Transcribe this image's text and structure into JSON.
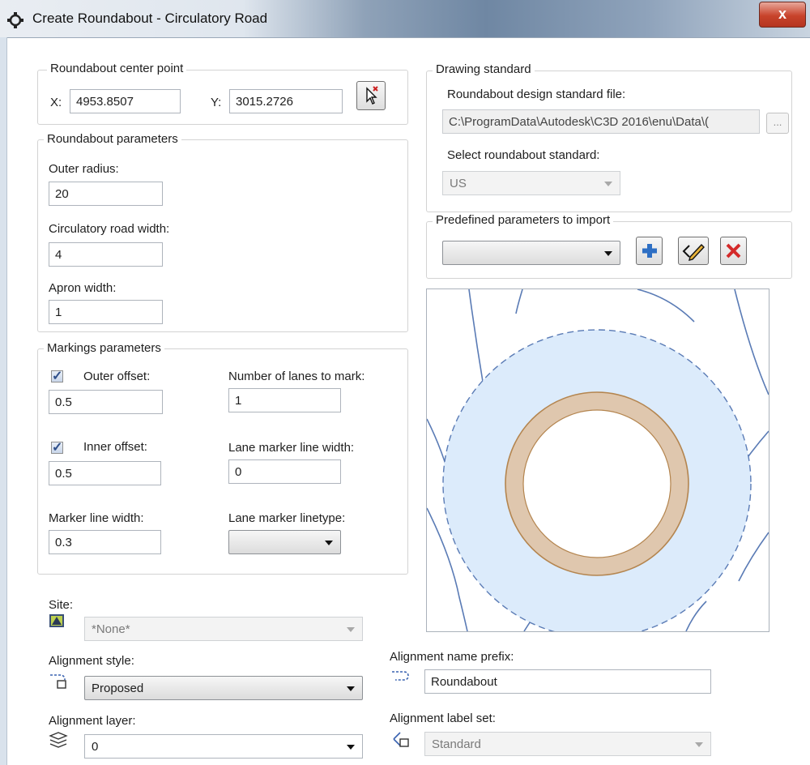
{
  "window": {
    "title": "Create Roundabout - Circulatory Road",
    "close_label": "x"
  },
  "center_point": {
    "group_label": "Roundabout center point",
    "x_label": "X:",
    "x_value": "4953.8507",
    "y_label": "Y:",
    "y_value": "3015.2726"
  },
  "roundabout_params": {
    "group_label": "Roundabout parameters",
    "outer_radius_label": "Outer radius:",
    "outer_radius": "20",
    "road_width_label": "Circulatory road width:",
    "road_width": "4",
    "apron_width_label": "Apron width:",
    "apron_width": "1"
  },
  "markings": {
    "group_label": "Markings parameters",
    "outer_offset_label": "Outer offset:",
    "outer_offset_checked": true,
    "outer_offset": "0.5",
    "inner_offset_label": "Inner offset:",
    "inner_offset_checked": true,
    "inner_offset": "0.5",
    "marker_line_width_label": "Marker line width:",
    "marker_line_width": "0.3",
    "lanes_to_mark_label": "Number of lanes to mark:",
    "lanes_to_mark": "1",
    "lane_marker_line_width_label": "Lane marker line width:",
    "lane_marker_line_width": "0",
    "lane_marker_linetype_label": "Lane marker linetype:",
    "lane_marker_linetype": ""
  },
  "drawing_standard": {
    "group_label": "Drawing standard",
    "file_label": "Roundabout design standard file:",
    "file_path": "C:\\ProgramData\\Autodesk\\C3D 2016\\enu\\Data\\(",
    "browse_label": "...",
    "select_label": "Select roundabout standard:",
    "standard": "US"
  },
  "predefined": {
    "group_label": "Predefined parameters to import",
    "selected": ""
  },
  "site": {
    "label": "Site:",
    "value": "*None*"
  },
  "alignment_style": {
    "label": "Alignment style:",
    "value": "Proposed"
  },
  "alignment_layer": {
    "label": "Alignment layer:",
    "value": "0"
  },
  "alignment_prefix": {
    "label": "Alignment name prefix:",
    "value": "Roundabout"
  },
  "alignment_label_set": {
    "label": "Alignment label set:",
    "value": "Standard"
  },
  "colors": {
    "apron_fill": "#dfc7ae",
    "apron_stroke": "#b4854f",
    "circulatory_fill": "#dcebfb",
    "road_line": "#5a7bb5",
    "add_icon": "#2e6fc4",
    "delete_icon": "#d42a2a"
  },
  "icons": [
    "app-gear-icon",
    "pick-point-icon",
    "add-icon",
    "edit-icon",
    "delete-icon",
    "site-icon",
    "alignment-style-icon",
    "layer-icon",
    "name-prefix-icon",
    "label-set-icon"
  ]
}
